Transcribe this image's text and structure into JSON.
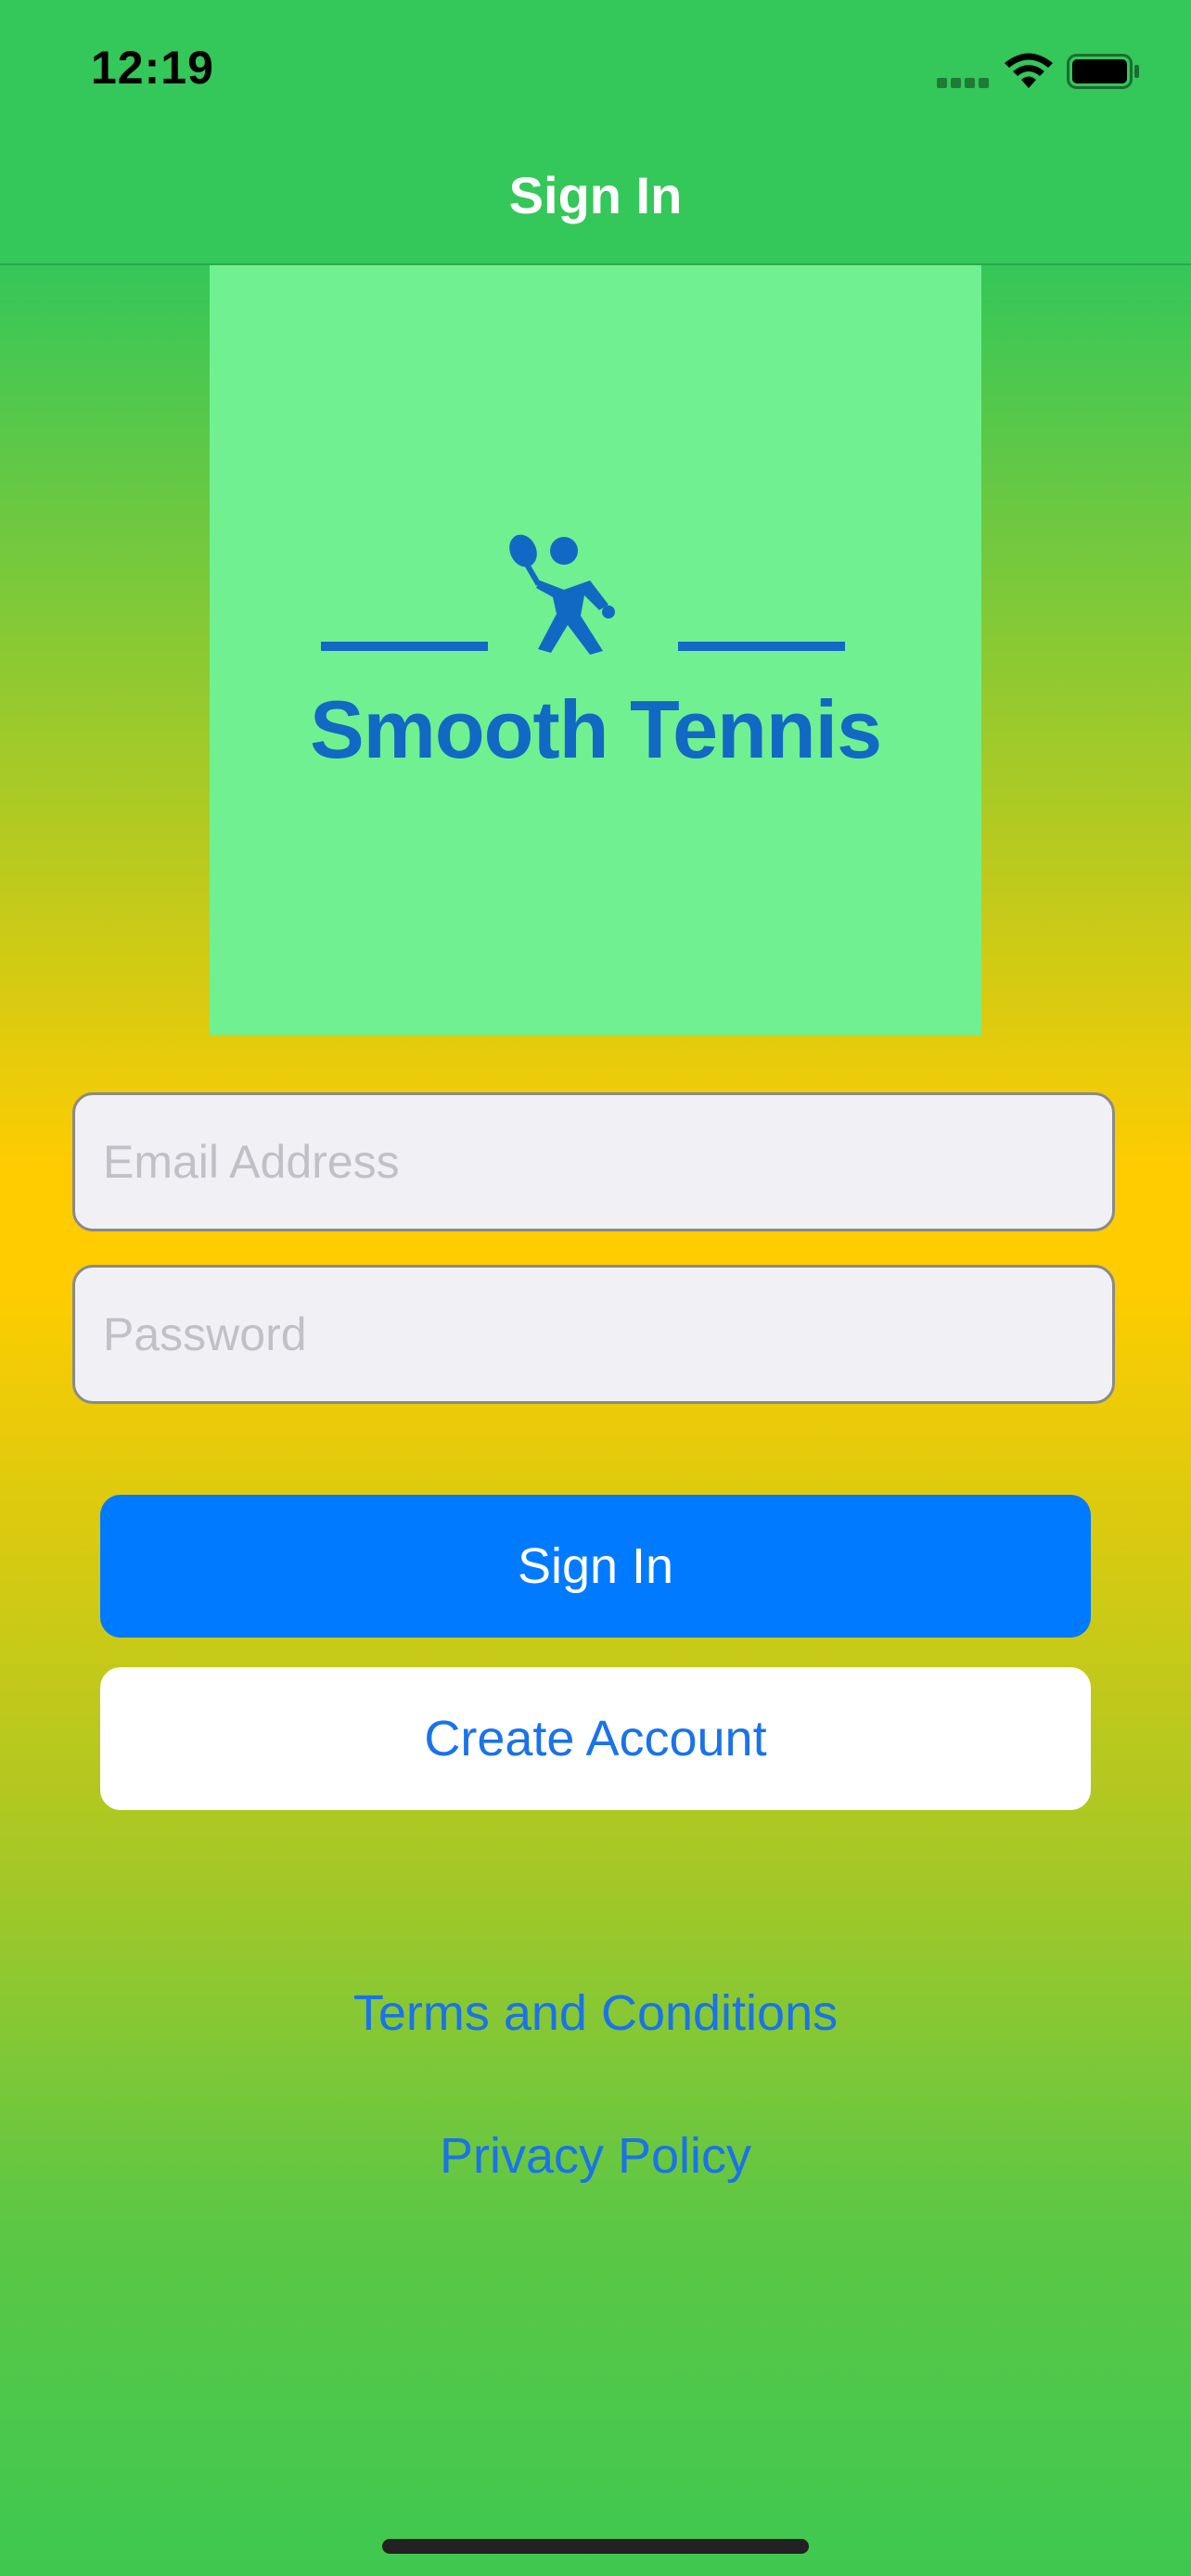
{
  "status_bar": {
    "time": "12:19"
  },
  "nav": {
    "title": "Sign In"
  },
  "logo": {
    "text": "Smooth Tennis"
  },
  "form": {
    "email_placeholder": "Email Address",
    "email_value": "",
    "password_placeholder": "Password",
    "password_value": ""
  },
  "buttons": {
    "sign_in": "Sign In",
    "create_account": "Create Account"
  },
  "links": {
    "terms": "Terms and Conditions",
    "privacy": "Privacy Policy"
  },
  "icons": {
    "signal": "cellular-signal-icon",
    "wifi": "wifi-icon",
    "battery": "battery-icon",
    "logo": "tennis-player-icon"
  },
  "colors": {
    "nav_green": "#34c759",
    "accent_blue": "#007aff",
    "link_blue": "#1a73e8",
    "logo_bg": "#70f090",
    "logo_blue": "#1169c4",
    "gradient_yellow": "#ffcc00"
  }
}
